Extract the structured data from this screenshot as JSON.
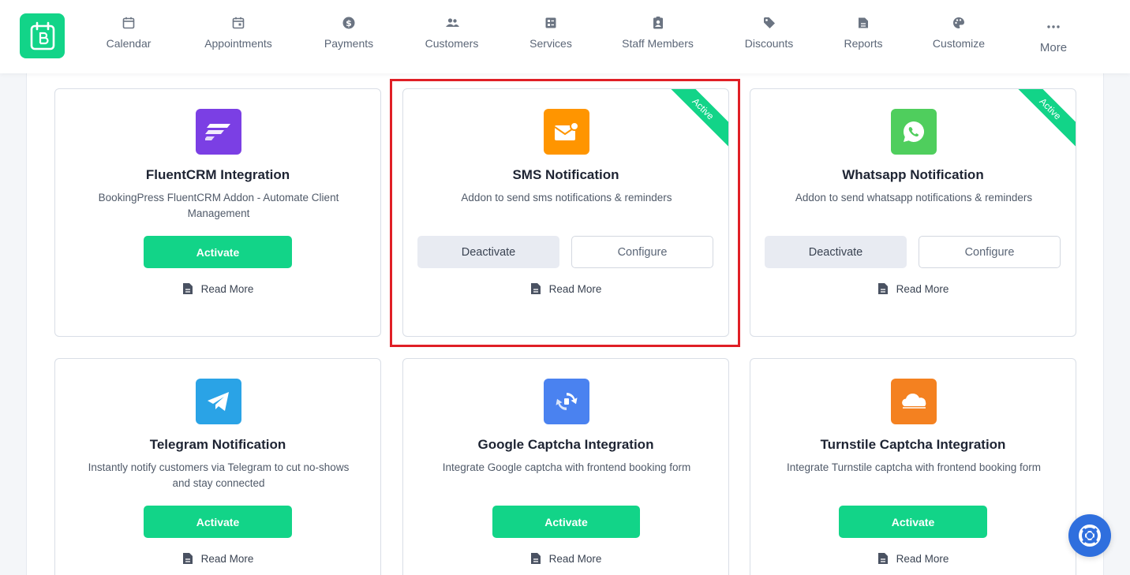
{
  "nav": {
    "items": [
      {
        "label": "Calendar",
        "icon": "calendar-icon"
      },
      {
        "label": "Appointments",
        "icon": "appointments-icon"
      },
      {
        "label": "Payments",
        "icon": "dollar-circle-icon"
      },
      {
        "label": "Customers",
        "icon": "customers-icon"
      },
      {
        "label": "Services",
        "icon": "services-icon"
      },
      {
        "label": "Staff Members",
        "icon": "staff-badge-icon"
      },
      {
        "label": "Discounts",
        "icon": "tag-icon"
      },
      {
        "label": "Reports",
        "icon": "report-icon"
      },
      {
        "label": "Customize",
        "icon": "palette-icon"
      },
      {
        "label": "More",
        "icon": "more-dots-icon"
      }
    ]
  },
  "addons": [
    {
      "title": "FluentCRM Integration",
      "desc": "BookingPress FluentCRM Addon - Automate Client Management",
      "status": "inactive",
      "activate_label": "Activate",
      "read_more": "Read More",
      "icon": "fluentcrm-icon",
      "icon_color": "#7b3fe4"
    },
    {
      "title": "SMS Notification",
      "desc": "Addon to send sms notifications & reminders",
      "status": "active",
      "ribbon": "Active",
      "deactivate_label": "Deactivate",
      "configure_label": "Configure",
      "read_more": "Read More",
      "icon": "sms-mail-icon",
      "icon_color": "#ff9500"
    },
    {
      "title": "Whatsapp Notification",
      "desc": "Addon to send whatsapp notifications & reminders",
      "status": "active",
      "ribbon": "Active",
      "deactivate_label": "Deactivate",
      "configure_label": "Configure",
      "read_more": "Read More",
      "icon": "whatsapp-icon",
      "icon_color": "#4fce5d"
    },
    {
      "title": "Telegram Notification",
      "desc": "Instantly notify customers via Telegram to cut no-shows and stay connected",
      "status": "inactive",
      "activate_label": "Activate",
      "read_more": "Read More",
      "icon": "telegram-icon",
      "icon_color": "#2aa3e6"
    },
    {
      "title": "Google Captcha Integration",
      "desc": "Integrate Google captcha with frontend booking form",
      "status": "inactive",
      "activate_label": "Activate",
      "read_more": "Read More",
      "icon": "recaptcha-icon",
      "icon_color": "#4a82f0"
    },
    {
      "title": "Turnstile Captcha Integration",
      "desc": "Integrate Turnstile captcha with frontend booking form",
      "status": "inactive",
      "activate_label": "Activate",
      "read_more": "Read More",
      "icon": "cloudflare-icon",
      "icon_color": "#f48120"
    }
  ],
  "colors": {
    "accent": "#12d488",
    "highlight": "#e01f26",
    "help_button": "#2f6fde"
  },
  "help": {
    "icon": "lifebuoy-icon"
  }
}
